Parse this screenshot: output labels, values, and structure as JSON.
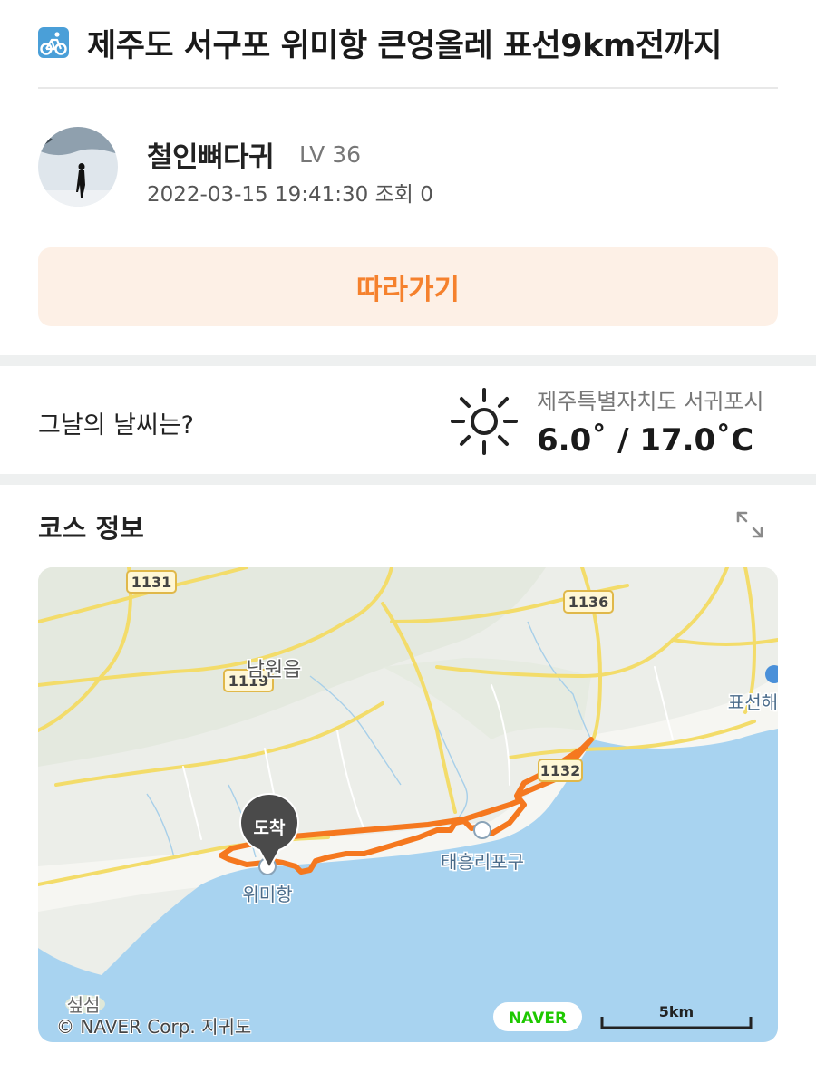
{
  "post": {
    "title": "제주도 서구포 위미항 큰엉올레 표선9km전까지",
    "title_icon": "bicycle-icon"
  },
  "author": {
    "name": "철인뼈다귀",
    "level": "LV 36",
    "meta": "2022-03-15 19:41:30 조회 0"
  },
  "follow_button": {
    "label": "따라가기"
  },
  "weather": {
    "label": "그날의 날씨는?",
    "icon": "sun-icon",
    "location": "제주특별자치도 서귀포시",
    "temperature": "6.0˚ / 17.0˚C"
  },
  "course": {
    "title": "코스 정보",
    "expand_icon": "expand-icon"
  },
  "map": {
    "arrival_marker": "도착",
    "place_labels": {
      "namwon": "남원읍",
      "pyoseon": "표선해",
      "taeheung": "태흥리포구",
      "wimi": "위미항",
      "seopseom": "섶섬"
    },
    "road_shields": [
      "1131",
      "1136",
      "1119",
      "1132"
    ],
    "copyright": "© NAVER Corp. 지귀도",
    "logo": "NAVER",
    "scale": "5km",
    "colors": {
      "route": "#f5781f",
      "sea": "#a8d3f0",
      "land": "#eceee9",
      "road": "#f6e07a",
      "marker": "#4a4a4a"
    }
  },
  "colors": {
    "accent": "#f5812d",
    "accent_bg": "#fdf0e6",
    "section_gap": "#eef0f0"
  }
}
